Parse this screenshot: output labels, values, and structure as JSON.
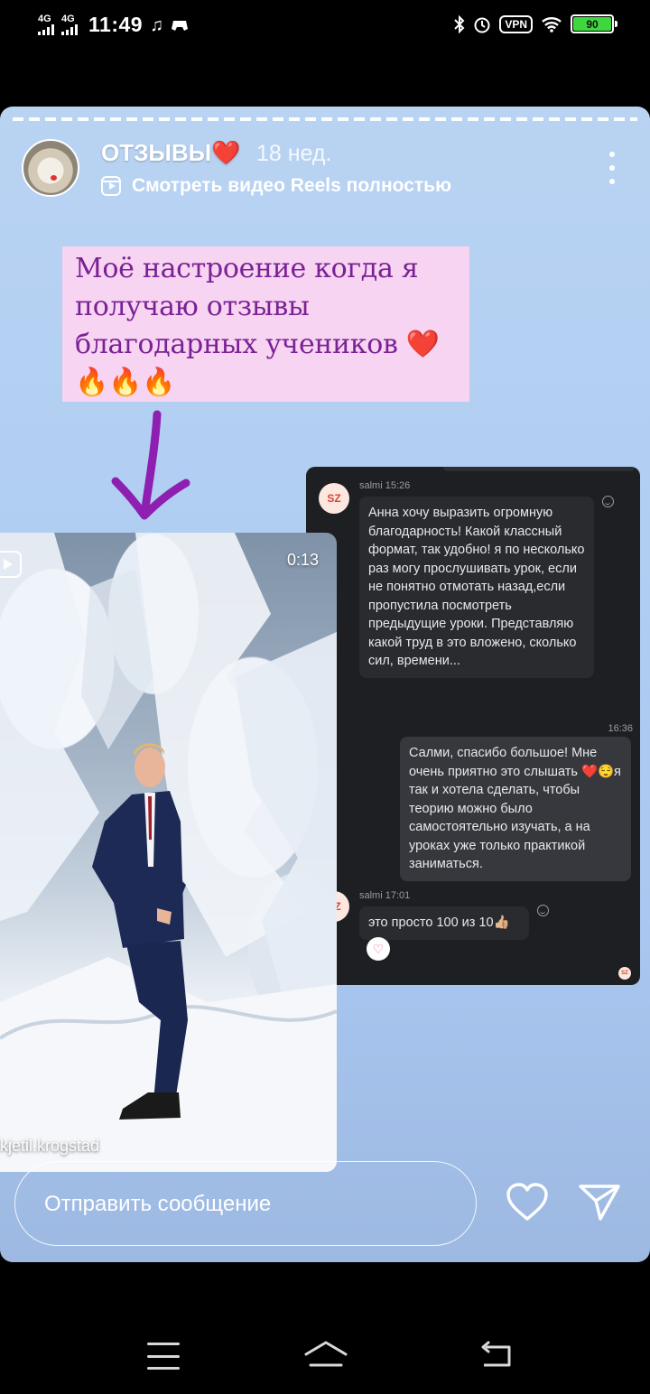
{
  "status_bar": {
    "signal1_label": "4G",
    "signal2_label": "4G",
    "time": "11:49",
    "vpn_label": "VPN",
    "battery_level": "90"
  },
  "story": {
    "author": "ОТЗЫВЫ❤️",
    "age": "18 нед.",
    "reels_link": "Смотреть видео Reels полностью",
    "sticker_text": "Моё настроение когда я получаю отзывы благодарных учеников ❤️🔥🔥🔥"
  },
  "chat": {
    "avatar_initials": "SZ",
    "msg1_meta": "salmi 15:26",
    "msg1_text": "Анна хочу выразить огромную благодарность! Какой классный формат, так удобно! я по несколько раз могу прослушивать урок, если не понятно отмотать назад,если пропустила посмотреть предыдущие уроки. Представляю какой труд в это вложено, сколько сил, времени...",
    "msg2_time": "16:36",
    "msg2_text": "Салми, спасибо большое! Мне очень приятно это слышать ❤️😌я так и хотела сделать, чтобы теорию можно было самостоятельно изучать, а на уроках уже только практикой заниматься.",
    "msg3_meta": "salmi 17:01",
    "msg3_text": "это просто 100 из 10👍🏼",
    "reaction": "♡"
  },
  "reel": {
    "duration": "0:13",
    "username": "kjetil.krogstad"
  },
  "reply": {
    "placeholder": "Отправить сообщение"
  },
  "colors": {
    "story_bg": "#b2cff3",
    "sticker_bg": "#f7d4f1",
    "sticker_text": "#7a2195",
    "arrow": "#8e1fb0",
    "chat_bg": "#1e1f22",
    "battery": "#3ed83e"
  },
  "icons": [
    "signal-icon",
    "music-note-icon",
    "gamepad-icon",
    "bluetooth-icon",
    "alarm-icon",
    "wifi-icon",
    "battery-icon",
    "reels-icon",
    "more-icon",
    "heart-icon",
    "send-icon",
    "menu-icon",
    "home-icon",
    "back-icon"
  ]
}
